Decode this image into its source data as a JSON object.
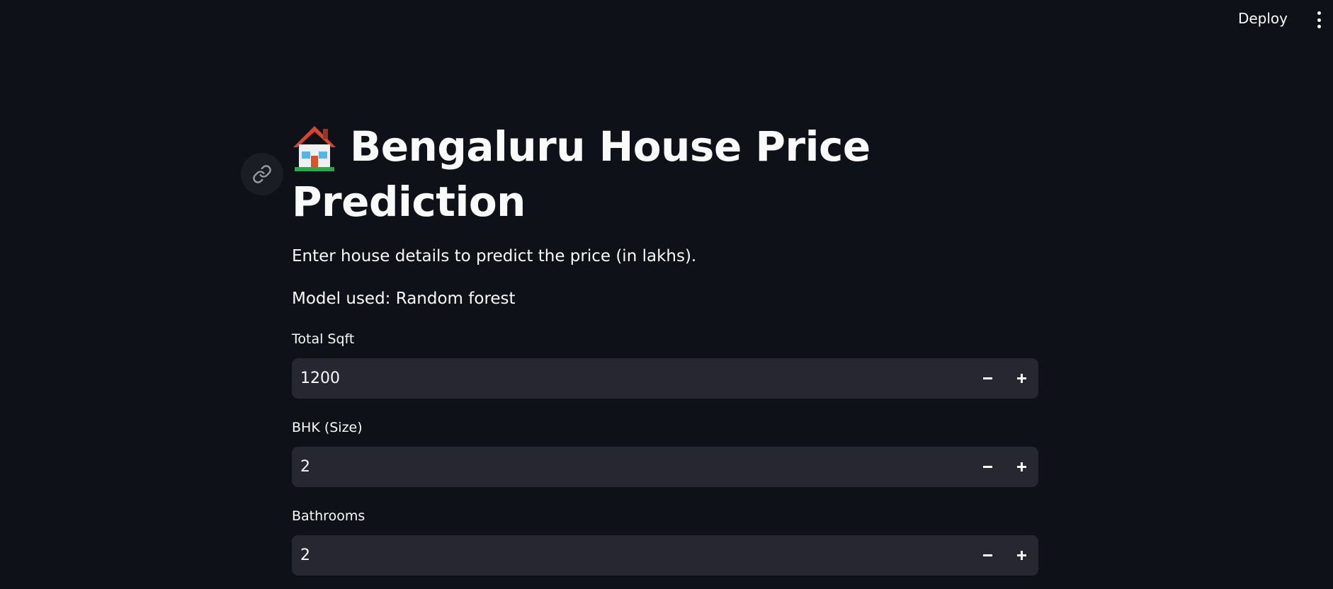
{
  "header": {
    "deploy_label": "Deploy",
    "menu_icon": "more-vertical-icon"
  },
  "page": {
    "title": "Bengaluru House Price Prediction",
    "title_icon": "house-emoji-icon",
    "description": "Enter house details to predict the price (in lakhs).",
    "model_text": "Model used: Random forest",
    "anchor_icon": "link-icon"
  },
  "fields": [
    {
      "label": "Total Sqft",
      "value": "1200"
    },
    {
      "label": "BHK (Size)",
      "value": "2"
    },
    {
      "label": "Bathrooms",
      "value": "2"
    }
  ],
  "colors": {
    "background": "#0e1117",
    "input_bg": "#262730",
    "text": "#fafafa"
  }
}
